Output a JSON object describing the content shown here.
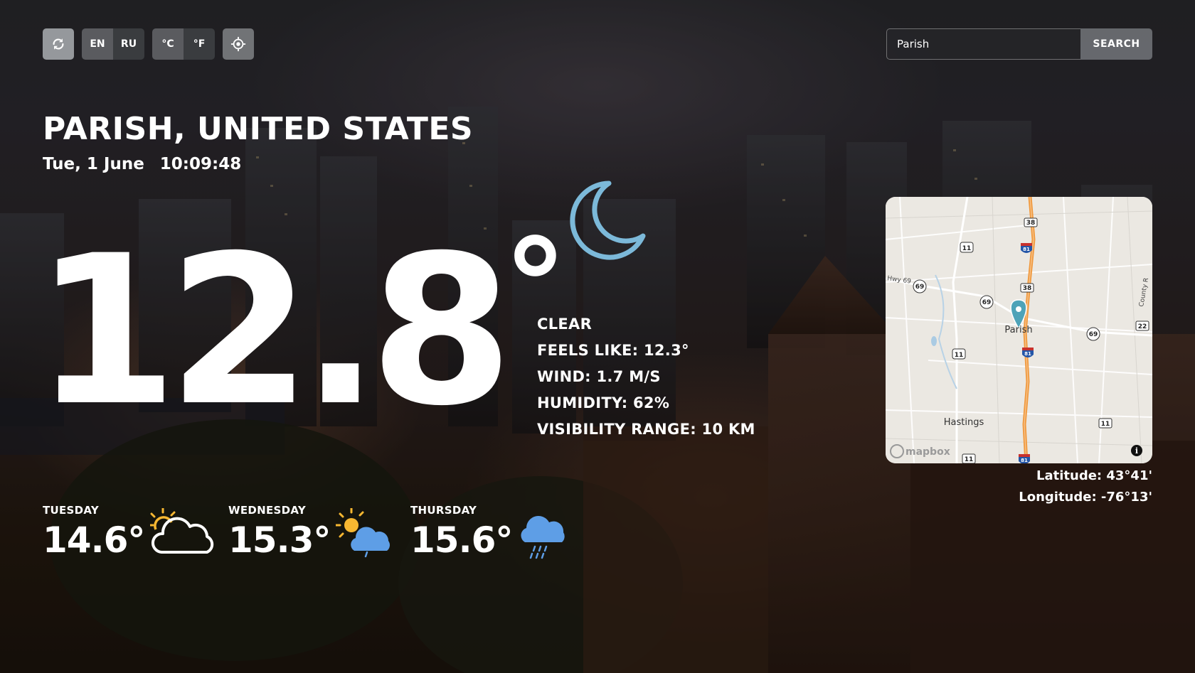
{
  "controls": {
    "language_options": [
      "EN",
      "RU"
    ],
    "selected_language": "EN",
    "unit_options": [
      "°C",
      "°F"
    ],
    "selected_unit": "°C"
  },
  "search": {
    "value": "Parish",
    "button_label": "SEARCH"
  },
  "location": {
    "title": "PARISH, UNITED STATES",
    "date": "Tue, 1 June",
    "time": "10:09:48"
  },
  "current": {
    "temperature": "12.8",
    "degree_symbol": "°",
    "icon": "moon-icon",
    "condition": "CLEAR",
    "feels_like": "FEELS LIKE: 12.3°",
    "wind": "WIND: 1.7 M/S",
    "humidity": "HUMIDITY: 62%",
    "visibility": "VISIBILITY RANGE: 10 KM"
  },
  "map": {
    "place_label": "Parish",
    "town_label": "Hastings",
    "road_labels": [
      "38",
      "81",
      "11",
      "69",
      "22",
      "Hwy 69",
      "County R"
    ],
    "brand": "mapbox",
    "latitude": "Latitude: 43°41'",
    "longitude": "Longitude: -76°13'"
  },
  "forecast": [
    {
      "day": "TUESDAY",
      "temp": "14.6°",
      "icon": "sun-cloud-icon"
    },
    {
      "day": "WEDNESDAY",
      "temp": "15.3°",
      "icon": "sun-blue-cloud-icon"
    },
    {
      "day": "THURSDAY",
      "temp": "15.6°",
      "icon": "rain-cloud-icon"
    }
  ],
  "colors": {
    "moon": "#7cb9d9",
    "cloud_blue": "#5e9ee6",
    "sun": "#f7b731",
    "map_route": "#f0993e",
    "map_pin": "#4ea3b8"
  }
}
